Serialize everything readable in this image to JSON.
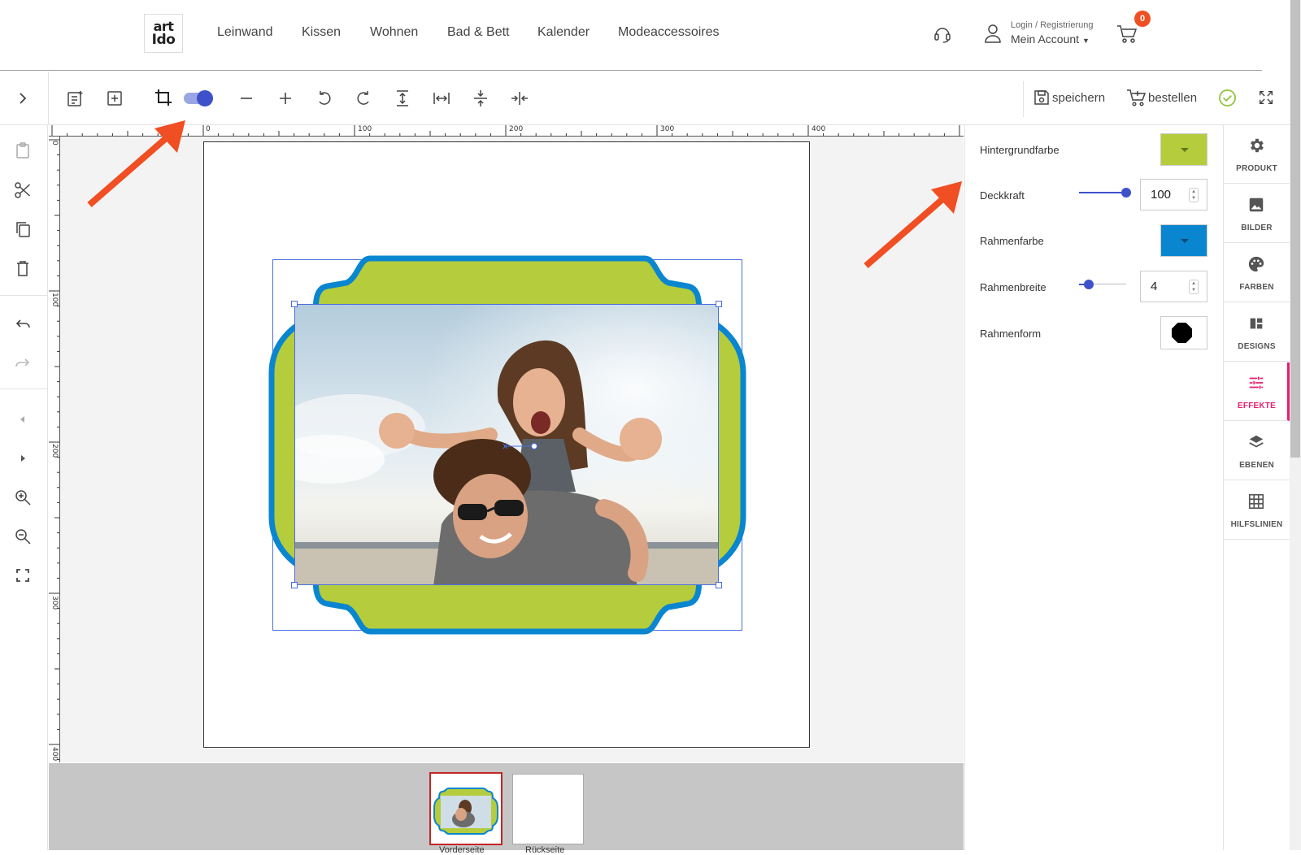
{
  "header": {
    "logo_top": "art",
    "logo_bottom": "Ido",
    "nav": [
      "Leinwand",
      "Kissen",
      "Wohnen",
      "Bad & Bett",
      "Kalender",
      "Modeaccessoires"
    ],
    "login_label": "Login / Registrierung",
    "account_label": "Mein Account",
    "cart_count": "0"
  },
  "toolbar": {
    "save_label": "speichern",
    "order_label": "bestellen"
  },
  "ruler": {
    "top_ticks": [
      "0",
      "100",
      "200",
      "300",
      "400"
    ],
    "left_ticks": [
      "0",
      "100",
      "200",
      "300",
      "400"
    ]
  },
  "pages": {
    "front_label": "Vorderseite",
    "back_label": "Rückseite"
  },
  "properties": {
    "background_color_label": "Hintergrundfarbe",
    "background_color": "#b5cc3c",
    "opacity_label": "Deckkraft",
    "opacity_value": "100",
    "frame_color_label": "Rahmenfarbe",
    "frame_color": "#0a86d0",
    "frame_width_label": "Rahmenbreite",
    "frame_width_value": "4",
    "frame_shape_label": "Rahmenform"
  },
  "right_panel": {
    "items": [
      {
        "label": "PRODUKT",
        "icon": "gear-icon"
      },
      {
        "label": "BILDER",
        "icon": "image-icon"
      },
      {
        "label": "FARBEN",
        "icon": "palette-icon"
      },
      {
        "label": "DESIGNS",
        "icon": "layout-icon"
      },
      {
        "label": "EFFEKTE",
        "icon": "sliders-icon"
      },
      {
        "label": "EBENEN",
        "icon": "layers-icon"
      },
      {
        "label": "HILFSLINIEN",
        "icon": "grid-icon"
      }
    ],
    "active": "EFFEKTE"
  },
  "colors": {
    "accent": "#3f51c8",
    "active_tab": "#e61e6e",
    "annotation_arrow": "#f04e23",
    "frame_fill": "#b5cc3c",
    "frame_stroke": "#0a86d0"
  }
}
